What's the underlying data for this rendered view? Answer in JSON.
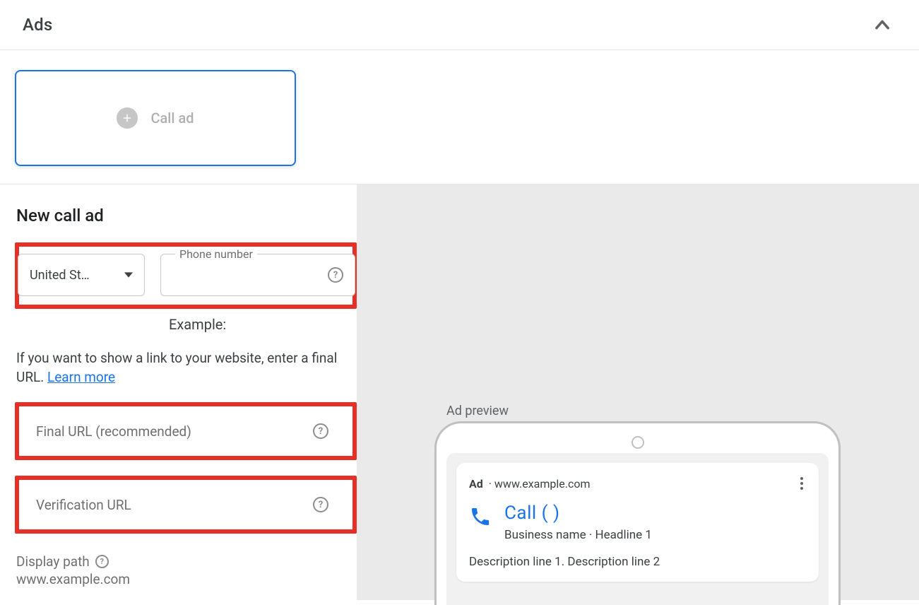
{
  "header": {
    "title": "Ads"
  },
  "card": {
    "call_ad_label": "Call ad"
  },
  "form": {
    "title": "New call ad",
    "country": "United St…",
    "phone_label": "Phone number",
    "example_label": "Example:",
    "hint_prefix": "If you want to show a link to your website, enter a final URL. ",
    "learn_more": "Learn more",
    "final_url_label": "Final URL (recommended)",
    "verification_url_label": "Verification URL",
    "display_path_label": "Display path",
    "display_path_url": "www.example.com"
  },
  "preview": {
    "title": "Ad preview",
    "ad_badge": "Ad",
    "ad_separator": "  ·  ",
    "ad_domain": "www.example.com",
    "call_label": "Call",
    "call_number": "(          )",
    "sub_business": "Business name",
    "sub_separator": " · ",
    "sub_headline": "Headline 1",
    "description": "Description line 1. Description line 2"
  }
}
